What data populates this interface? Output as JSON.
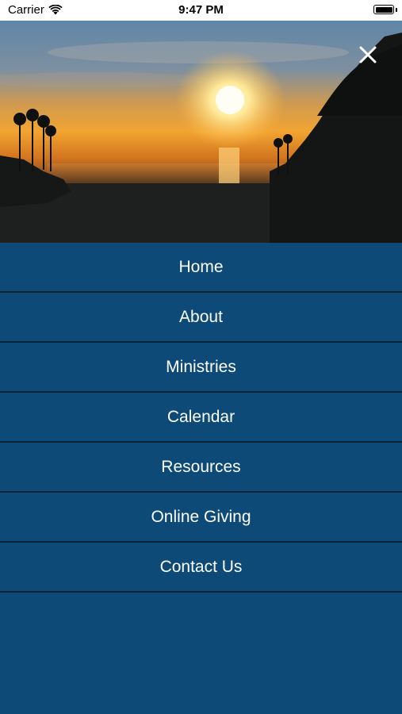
{
  "status_bar": {
    "carrier": "Carrier",
    "time": "9:47 PM",
    "wifi_icon": "wifi-icon",
    "battery_icon": "battery-icon"
  },
  "hero": {
    "image": "sunset-over-ocean-with-palm-trees",
    "close_icon": "close-icon"
  },
  "menu": {
    "items": [
      {
        "label": "Home"
      },
      {
        "label": "About"
      },
      {
        "label": "Ministries"
      },
      {
        "label": "Calendar"
      },
      {
        "label": "Resources"
      },
      {
        "label": "Online Giving"
      },
      {
        "label": "Contact Us"
      }
    ]
  },
  "colors": {
    "menu_background": "#0d4a78",
    "divider": "#0a2336",
    "text": "#ffffff"
  }
}
